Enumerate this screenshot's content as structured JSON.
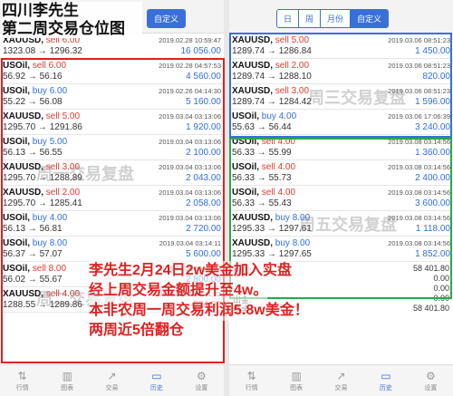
{
  "colors": {
    "sell": "#e23a2e",
    "buy": "#2f6fe0",
    "accent": "#3a6fd8",
    "mark_red": "#e02020",
    "mark_green": "#2aa84a"
  },
  "overlay": {
    "title1": "四川李先生",
    "title2": "第二周交易仓位图",
    "wm_left1": "周一交易复盘",
    "wm_left2": "周二交易复盘",
    "wm_right1": "周三交易复盘",
    "wm_right2": "周五交易复盘",
    "promo": [
      "李先生2月24日2w美金加入实盘",
      "经上周交易金额提升至4w。",
      "本非农周一周交易利润5.8w美金！",
      "两周近5倍翻仓"
    ]
  },
  "left": {
    "segments": [
      "自定义"
    ],
    "trades": [
      {
        "sym": "XAUUSD",
        "side": "sell 6.00",
        "price": "1323.08 → 1296.32",
        "date": "2019.02.28 10:59:47",
        "pl": "16 056.00"
      },
      {
        "sym": "USOil",
        "side": "sell 6.00",
        "price": "56.92 → 56.16",
        "date": "2019.02.28 04:57:53",
        "pl": "4 560.00"
      },
      {
        "sym": "USOil",
        "side": "buy 6.00",
        "price": "55.22 → 56.08",
        "date": "2019.02.26 04:14:30",
        "pl": "5 160.00"
      },
      {
        "sym": "XAUUSD",
        "side": "sell 5.00",
        "price": "1295.70 → 1291.86",
        "date": "2019.03.04 03:13:06",
        "pl": "1 920.00"
      },
      {
        "sym": "USOil",
        "side": "buy 5.00",
        "price": "56.13 → 56.55",
        "date": "2019.03.04 03:13:06",
        "pl": "2 100.00"
      },
      {
        "sym": "XAUUSD",
        "side": "sell 3.00",
        "price": "1295.70 → 1288.89",
        "date": "2019.03.04 03:13:06",
        "pl": "2 043.00"
      },
      {
        "sym": "XAUUSD",
        "side": "sell 2.00",
        "price": "1295.70 → 1285.41",
        "date": "2019.03.04 03:13:06",
        "pl": "2 058.00"
      },
      {
        "sym": "USOil",
        "side": "buy 4.00",
        "price": "56.13 → 56.81",
        "date": "2019.03.04 03:13:06",
        "pl": "2 720.00"
      },
      {
        "sym": "USOil",
        "side": "buy 8.00",
        "price": "56.37 → 57.07",
        "date": "2019.03.04 03:14:11",
        "pl": "5 600.00"
      },
      {
        "sym": "USOil",
        "side": "sell 8.00",
        "price": "56.02 → 55.67",
        "date": "2019.03.05 03:41:22",
        "pl": "2 800.00"
      },
      {
        "sym": "XAUUSD",
        "side": "sell 4.00",
        "price": "1288.55 → 1289.86",
        "date": "2019.03.05 03:41:22",
        "pl": "-524.00"
      }
    ],
    "tabs": [
      "行情",
      "图表",
      "交易",
      "历史",
      "设置"
    ]
  },
  "right": {
    "segments": [
      "日",
      "周",
      "月份",
      "自定义"
    ],
    "trades": [
      {
        "sym": "XAUUSD",
        "side": "sell 5.00",
        "price": "1289.74 → 1286.84",
        "date": "2019.03.06 08:51:23",
        "pl": "1 450.00"
      },
      {
        "sym": "XAUUSD",
        "side": "sell 2.00",
        "price": "1289.74 → 1288.10",
        "date": "2019.03.06 08:51:23",
        "pl": "820.00"
      },
      {
        "sym": "XAUUSD",
        "side": "sell 3.00",
        "price": "1289.74 → 1284.42",
        "date": "2019.03.06 08:51:23",
        "pl": "1 596.00"
      },
      {
        "sym": "USOil",
        "side": "buy 4.00",
        "price": "55.63 → 56.44",
        "date": "2019.03.06 17:06:39",
        "pl": "3 240.00"
      },
      {
        "sym": "USOil",
        "side": "sell 4.00",
        "price": "56.33 → 55.99",
        "date": "2019.03.08 03:14:56",
        "pl": "1 360.00"
      },
      {
        "sym": "USOil",
        "side": "sell 4.00",
        "price": "56.33 → 55.73",
        "date": "2019.03.08 03:14:56",
        "pl": "2 400.00"
      },
      {
        "sym": "USOil",
        "side": "sell 4.00",
        "price": "56.33 → 55.43",
        "date": "2019.03.08 03:14:56",
        "pl": "3 600.00"
      },
      {
        "sym": "XAUUSD",
        "side": "buy 8.00",
        "price": "1295.33 → 1297.61",
        "date": "2019.03.08 03:14:56",
        "pl": "1 118.00"
      },
      {
        "sym": "XAUUSD",
        "side": "buy 8.00",
        "price": "1295.33 → 1297.65",
        "date": "2019.03.08 03:14:56",
        "pl": "1 852.00"
      }
    ],
    "summary": [
      {
        "label": "利润:",
        "value": "58 401.80"
      },
      {
        "label": "",
        "value": "0.00"
      },
      {
        "label": "",
        "value": "0.00"
      },
      {
        "label": "出金:",
        "value": "0.00"
      },
      {
        "label": "结余:",
        "value": "58 401.80"
      }
    ],
    "tabs": [
      "行情",
      "图表",
      "交易",
      "历史",
      "设置"
    ]
  }
}
